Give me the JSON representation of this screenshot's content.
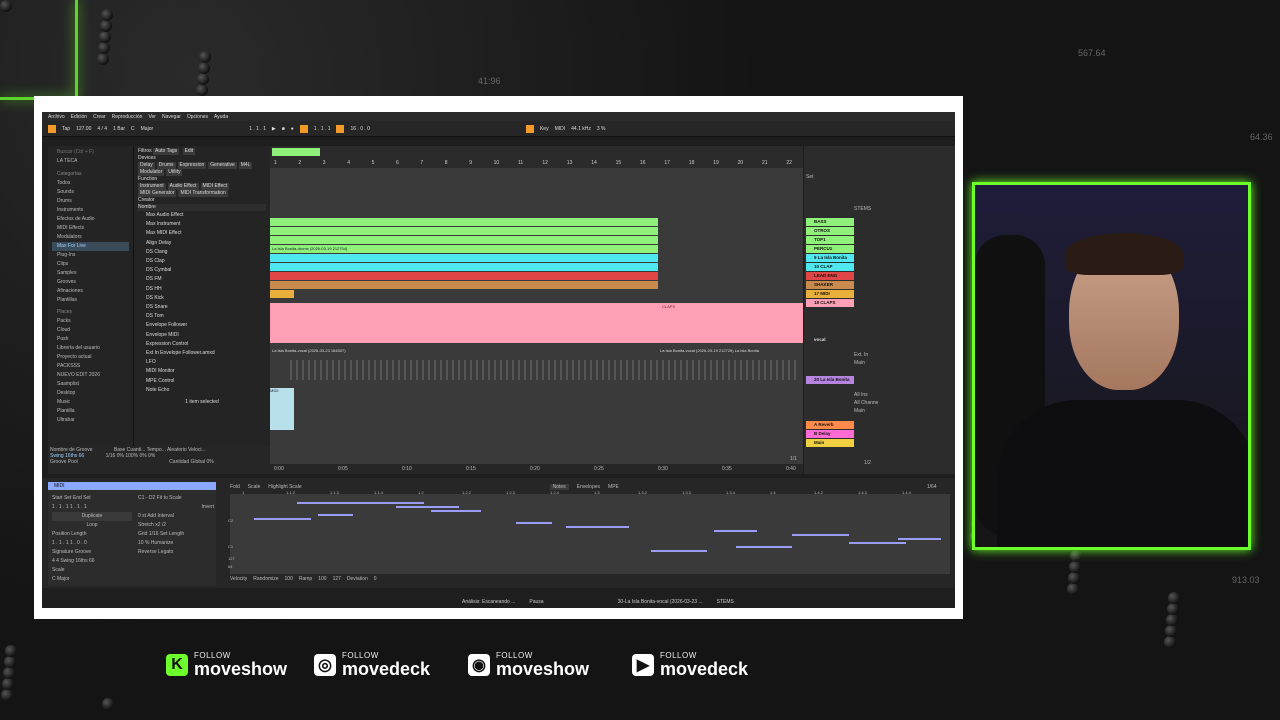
{
  "background": {
    "numbers": [
      "41:96",
      "567.64",
      "64.36",
      "913.03"
    ]
  },
  "menu": [
    "Archivo",
    "Edición",
    "Crear",
    "Reproducción",
    "Ver",
    "Navegar",
    "Opciones",
    "Ayuda"
  ],
  "transport": {
    "tap": "Tap",
    "tempo": "127.00",
    "sig": "4 / 4",
    "bar": "1 Bar",
    "key": "C",
    "scale": "Major",
    "pos1": "1 . 1 . 1",
    "pos2": "1 . 1 . 1",
    "len": "16 . 0 . 0",
    "key_label": "Key",
    "midi": "MIDI",
    "sr": "44.1 kHz",
    "cpu": "3 %"
  },
  "browser": {
    "search": "Buscar (Ctrl + F)",
    "collection": "LA TECA",
    "categories_title": "Categorías",
    "categories": [
      "Todos",
      "Sounds",
      "Drums",
      "Instruments",
      "Efectos de Audio",
      "MIDI Effects",
      "Modulators",
      "Max For Live",
      "Plug-Ins",
      "Clips",
      "Samples",
      "Grooves",
      "Afinaciones",
      "Plantillas"
    ],
    "places_title": "Places",
    "places": [
      "Packs",
      "Cloud",
      "Push",
      "Librería del usuario",
      "Proyecto actual",
      "PACKSSS",
      "NUEVO EDIT 2026",
      "Saamplist",
      "Desktop",
      "Music",
      "Plantilla",
      "Ultrabar"
    ],
    "filters_label": "Filtros",
    "autotags": "Auto Tags",
    "edit": "Edit",
    "devices_label": "Devices",
    "devices": [
      "Delay",
      "Drums",
      "Expression",
      "Generative",
      "M4L",
      "Modulator",
      "Utility"
    ],
    "function_label": "Function",
    "functions": [
      "Instrument",
      "Audio Effect",
      "MIDI Effect",
      "MIDI Generator",
      "MIDI Transformation"
    ],
    "creator_label": "Creator",
    "name_col": "Nombre",
    "items": [
      "Max Audio Effect",
      "Max Instrument",
      "Max MIDI Effect",
      "Align Delay",
      "DS Clang",
      "DS Clap",
      "DS Cymbal",
      "DS FM",
      "DS HH",
      "DS Kick",
      "DS Snare",
      "DS Tom",
      "Envelope Follower",
      "Envelope MIDI",
      "Expression Control",
      "Ext In Envelope Follower.amxd",
      "LFO",
      "MIDI Monitor",
      "MPE Control",
      "Note Echo"
    ],
    "selected": "1 item selected",
    "groove_name": "Nombre de Groove",
    "groove_cols": [
      "Base",
      "Cuanti...",
      "Tempo...",
      "Aleatorio",
      "Veloci..."
    ],
    "groove_row": [
      "Swing 16ths 66",
      "1/16",
      "0%",
      "100%",
      "0%",
      "0%"
    ],
    "groove_pool": "Groove Pool",
    "global": "Cantidad Global",
    "global_val": "0%"
  },
  "tracks": {
    "ruler": [
      "1",
      "2",
      "3",
      "4",
      "5",
      "6",
      "7",
      "8",
      "9",
      "10",
      "11",
      "12",
      "13",
      "14",
      "15",
      "16",
      "17",
      "18",
      "19",
      "20",
      "21",
      "22"
    ],
    "clip_text": "La Isla Bonita",
    "drum_clip": "La Isla Bonita-drums (2026-03-19 212704)",
    "claps": "CLAPS",
    "vocal1": "La Isla Bonita-vocal (2026-03-23 184507)",
    "vocal2": "La Isla Bonita-vocal (2026-03-19 212726) La Isla Bonita",
    "midi_clip": "MIDI",
    "timeline": [
      "0:00",
      "0:05",
      "0:10",
      "0:15",
      "0:20",
      "0:25",
      "0:30",
      "0:35",
      "0:40"
    ],
    "page": "1/1",
    "set": "Set",
    "names": [
      "BASS",
      "OTROS",
      "TOP1",
      "PERCU1",
      "9 La Isla Bonita",
      "10 CLAP",
      "LEAD ENG",
      "SHAKER",
      "17 MIDI",
      "18 CLAPS",
      "vocal",
      "20 La Isla Bonita",
      "A Reverb",
      "B Delay",
      "Main"
    ],
    "colors": [
      "#8ff07a",
      "#8ff07a",
      "#8ff07a",
      "#8ff07a",
      "#4fe8f0",
      "#4fe8f0",
      "#e04646",
      "#c98a4d",
      "#e8b03a",
      "#ff9fb5",
      "#888888",
      "#b784e0",
      "#ff8a4a",
      "#ff6bd5",
      "#f0d040"
    ],
    "stems": "STEMS",
    "inputs": [
      "Ext. In",
      "All Ins",
      "All Channe",
      "Main",
      "Ext. In",
      "Main"
    ],
    "sends": "1/2"
  },
  "clip": {
    "title": "MIDI",
    "start": "Start",
    "end": "End",
    "set": "Set",
    "s_val": "1 . 1 . 1",
    "e_val": "1 . 1 . 1",
    "duplicate": "Duplicate",
    "loop": "Loop",
    "position": "Position",
    "length": "Length",
    "p_val": "1 . 1 . 1",
    "l_val": "1 . 0 . 0",
    "signature": "Signature",
    "groove": "Groove",
    "sig_a": "4",
    "sig_b": "4",
    "groove_val": "Swing 16ths 66",
    "scale": "Scale",
    "scale_key": "C",
    "scale_name": "Major",
    "range": "C1 - D2",
    "fit": "Fit to Scale",
    "invert": "Invert",
    "add_interval": "Add Interval",
    "zero": "0 st",
    "stretch": "Stretch",
    "x2": "x2",
    "d2": "/2",
    "grid": "Grid",
    "quant": "1/16",
    "set_length": "Set Length",
    "swing": "10 %",
    "humanize": "Humanize",
    "reverse": "Reverse",
    "legato": "Legato"
  },
  "editor": {
    "fold": "Fold",
    "scale": "Scale",
    "highlight": "Highlight Scale",
    "tabs": [
      "Notes",
      "Envelopes",
      "MPE"
    ],
    "grid": "1/64",
    "bars": [
      "1",
      "1.1.2",
      "1.1.3",
      "1.1.4",
      "1.2",
      "1.2.2",
      "1.2.3",
      "1.2.4",
      "1.3",
      "1.3.2",
      "1.3.3",
      "1.3.4",
      "1.4",
      "1.4.2",
      "1.4.3",
      "1.4.4"
    ],
    "keys": [
      "C2",
      "C1"
    ],
    "vel_labels": [
      "127",
      "64"
    ],
    "velocity": "Velocity",
    "randomize": "Randomize",
    "rand_val": "100",
    "ramp": "Ramp",
    "ramp_a": "100",
    "ramp_b": "127",
    "deviation": "Deviation",
    "dev_val": "0"
  },
  "status": {
    "analysis": "Análisis: Escaneando ...",
    "pause": "Pausa",
    "clip": "30-La Isla Bonita-vocal (2026-03-23 ...",
    "stems": "STEMS"
  },
  "social": [
    {
      "follow": "FOLLOW",
      "name": "moveshow",
      "icon": "K"
    },
    {
      "follow": "FOLLOW",
      "name": "movedeck",
      "icon": "◎"
    },
    {
      "follow": "FOLLOW",
      "name": "moveshow",
      "icon": "◉"
    },
    {
      "follow": "FOLLOW",
      "name": "movedeck",
      "icon": "▶"
    }
  ],
  "notes": [
    [
      0,
      0.08,
      0.26
    ],
    [
      1,
      0.22,
      0.31
    ],
    [
      2,
      0.27,
      0.34
    ],
    [
      3,
      0.11,
      0.16
    ],
    [
      4,
      0.02,
      0.1
    ],
    [
      5,
      0.39,
      0.44
    ],
    [
      6,
      0.46,
      0.55
    ],
    [
      7,
      0.67,
      0.73
    ],
    [
      8,
      0.78,
      0.86
    ],
    [
      9,
      0.93,
      0.99
    ],
    [
      10,
      0.86,
      0.94
    ],
    [
      11,
      0.7,
      0.78
    ],
    [
      12,
      0.58,
      0.66
    ]
  ]
}
